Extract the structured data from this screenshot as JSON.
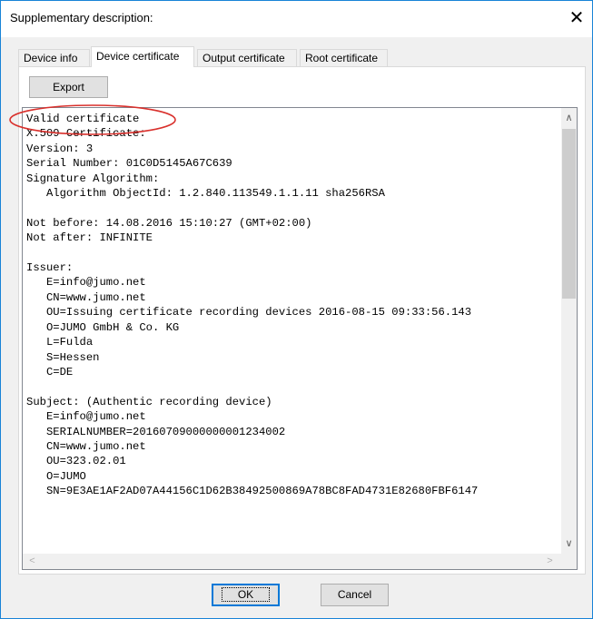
{
  "window": {
    "title": "Supplementary description:",
    "close_glyph": "✕"
  },
  "tabs": [
    {
      "label": "Device info",
      "active": false
    },
    {
      "label": "Device certificate",
      "active": true
    },
    {
      "label": "Output certificate",
      "active": false
    },
    {
      "label": "Root certificate",
      "active": false
    }
  ],
  "toolbar": {
    "export_label": "Export"
  },
  "certificate_lines": [
    "Valid certificate",
    "X.509 Certificate:",
    "Version: 3",
    "Serial Number: 01C0D5145A67C639",
    "Signature Algorithm:",
    "   Algorithm ObjectId: 1.2.840.113549.1.1.11 sha256RSA",
    "",
    "Not before: 14.08.2016 15:10:27 (GMT+02:00)",
    "Not after: INFINITE",
    "",
    "Issuer:",
    "   E=info@jumo.net",
    "   CN=www.jumo.net",
    "   OU=Issuing certificate recording devices 2016-08-15 09:33:56.143",
    "   O=JUMO GmbH & Co. KG",
    "   L=Fulda",
    "   S=Hessen",
    "   C=DE",
    "",
    "Subject: (Authentic recording device)",
    "   E=info@jumo.net",
    "   SERIALNUMBER=20160709000000001234002",
    "   CN=www.jumo.net",
    "   OU=323.02.01",
    "   O=JUMO",
    "   SN=9E3AE1AF2AD07A44156C1D62B38492500869A78BC8FAD4731E82680FBF6147"
  ],
  "scrollbar": {
    "up_glyph": "∧",
    "down_glyph": "∨",
    "left_glyph": "<",
    "right_glyph": ">"
  },
  "buttons": {
    "ok_label": "OK",
    "cancel_label": "Cancel"
  },
  "colors": {
    "annotation_circle": "#d9302c",
    "focus_border": "#0078d7"
  }
}
